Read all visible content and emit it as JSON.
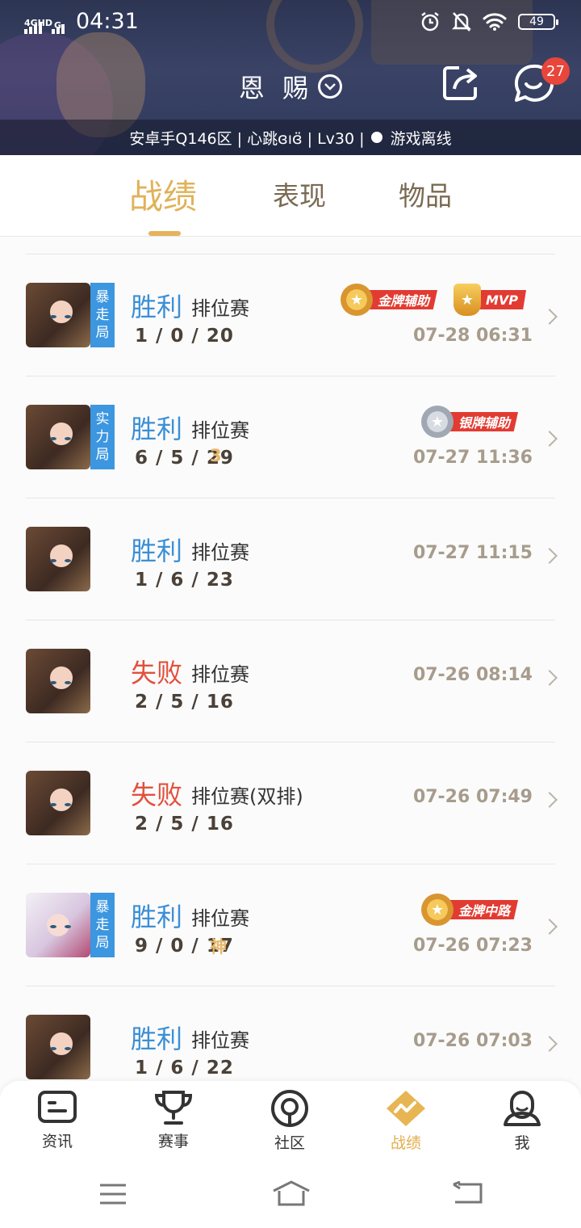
{
  "status_bar": {
    "network": "4GHD",
    "network2": "G",
    "time": "04:31",
    "battery": "49"
  },
  "header": {
    "title": "恩 赐",
    "unread_count": "27",
    "profile_line": "安卓手Q146区 | 心跳ɞıɞ̈ | Lv30 |",
    "status": "游戏离线"
  },
  "tabs": [
    {
      "label": "战绩"
    },
    {
      "label": "表现"
    },
    {
      "label": "物品"
    }
  ],
  "matches": [
    {
      "result": "胜利",
      "mode": "排位赛",
      "kda": "1 / 0 / 20",
      "date": "07-28 06:31",
      "tag": [
        "暴",
        "走",
        "局"
      ],
      "mark": "",
      "medals": [
        "金牌辅助",
        "MVP"
      ]
    },
    {
      "result": "胜利",
      "mode": "排位赛",
      "kda": "6 / 5 / 29",
      "date": "07-27 11:36",
      "tag": [
        "实",
        "力",
        "局"
      ],
      "mark": "3",
      "medals": [
        "银牌辅助"
      ]
    },
    {
      "result": "胜利",
      "mode": "排位赛",
      "kda": "1 / 6 / 23",
      "date": "07-27 11:15",
      "tag": [],
      "mark": "",
      "medals": []
    },
    {
      "result": "失败",
      "mode": "排位赛",
      "kda": "2 / 5 / 16",
      "date": "07-26 08:14",
      "tag": [],
      "mark": "",
      "medals": []
    },
    {
      "result": "失败",
      "mode": "排位赛(双排)",
      "kda": "2 / 5 / 16",
      "date": "07-26 07:49",
      "tag": [],
      "mark": "",
      "medals": []
    },
    {
      "result": "胜利",
      "mode": "排位赛",
      "kda": "9 / 0 / 17",
      "date": "07-26 07:23",
      "tag": [
        "暴",
        "走",
        "局"
      ],
      "mark": "神",
      "medals": [
        "金牌中路"
      ]
    },
    {
      "result": "胜利",
      "mode": "排位赛",
      "kda": "1 / 6 / 22",
      "date": "07-26 07:03",
      "tag": [],
      "mark": "",
      "medals": []
    }
  ],
  "bottom_nav": [
    {
      "label": "资讯"
    },
    {
      "label": "赛事"
    },
    {
      "label": "社区"
    },
    {
      "label": "战绩"
    },
    {
      "label": "我"
    }
  ],
  "colors": {
    "accent": "#e0b25a",
    "win": "#3b8fd6",
    "lose": "#e2503c",
    "medal_red": "#e23b32"
  }
}
